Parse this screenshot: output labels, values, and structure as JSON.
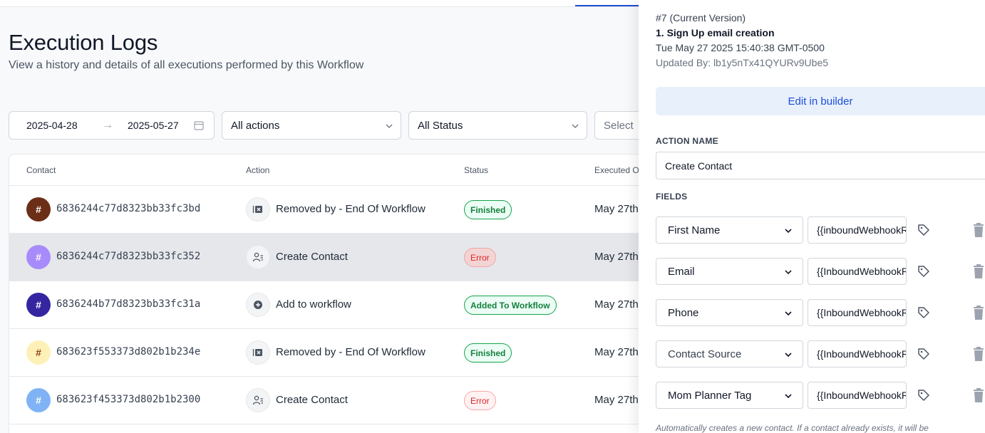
{
  "page": {
    "title": "Execution Logs",
    "subtitle": "View a history and details of all executions performed by this Workflow"
  },
  "filters": {
    "date_start": "2025-04-28",
    "date_end": "2025-05-27",
    "actions_select": "All actions",
    "status_select": "All Status",
    "third_select": "Select"
  },
  "table": {
    "headers": {
      "contact": "Contact",
      "action": "Action",
      "status": "Status",
      "executed": "Executed O"
    },
    "rows": [
      {
        "avatar_glyph": "#",
        "avatar_color": "#6b2e16",
        "contact": "6836244c77d8323bb33fc3bd",
        "action_icon": "remove-icon",
        "action": "Removed by - End Of Workflow",
        "status": "Finished",
        "status_kind": "ok",
        "executed": "May 27th"
      },
      {
        "avatar_glyph": "#",
        "avatar_color": "#a78bfa",
        "contact": "6836244c77d8323bb33fc352",
        "action_icon": "user-icon",
        "action": "Create Contact",
        "status": "Error",
        "status_kind": "err",
        "executed": "May 27th",
        "selected": true
      },
      {
        "avatar_glyph": "#",
        "avatar_color": "#3525a0",
        "contact": "6836244b77d8323bb33fc31a",
        "action_icon": "add-circle-icon",
        "action": "Add to workflow",
        "status": "Added To Workflow",
        "status_kind": "ok",
        "executed": "May 27th"
      },
      {
        "avatar_glyph": "#",
        "avatar_color": "#fdf1b8",
        "avatar_text_color": "#92400e",
        "contact": "683623f553373d802b1b234e",
        "action_icon": "remove-icon",
        "action": "Removed by - End Of Workflow",
        "status": "Finished",
        "status_kind": "ok",
        "executed": "May 27th"
      },
      {
        "avatar_glyph": "#",
        "avatar_color": "#7fb3f5",
        "contact": "683623f453373d802b1b2300",
        "action_icon": "user-icon",
        "action": "Create Contact",
        "status": "Error",
        "status_kind": "err",
        "executed": "May 27th"
      }
    ]
  },
  "panel": {
    "version": "#7 (Current Version)",
    "step": "1. Sign Up email creation",
    "timestamp": "Tue May 27 2025 15:40:38 GMT-0500",
    "updated_by": "Updated By: lb1y5nTx41QYURv9Ube5",
    "edit_button": "Edit in builder",
    "action_name_label": "ACTION NAME",
    "action_name_value": "Create Contact",
    "fields_label": "FIELDS",
    "fields": [
      {
        "name": "First Name",
        "value": "{{inboundWebhookRequest"
      },
      {
        "name": "Email",
        "value": "{{InboundWebhookRequest"
      },
      {
        "name": "Phone",
        "value": "{{InboundWebhookRequest"
      },
      {
        "name": "Contact Source",
        "value": "{{InboundWebhookRequest",
        "placeholder_style": true
      },
      {
        "name": "Mom Planner Tag",
        "value": "{{InboundWebhookRequest"
      }
    ],
    "footnote": "Automatically creates a new contact. If a contact already exists, it will be"
  },
  "colors": {
    "accent": "#1d4ed8",
    "success": "#15803d",
    "error": "#dc2626"
  }
}
